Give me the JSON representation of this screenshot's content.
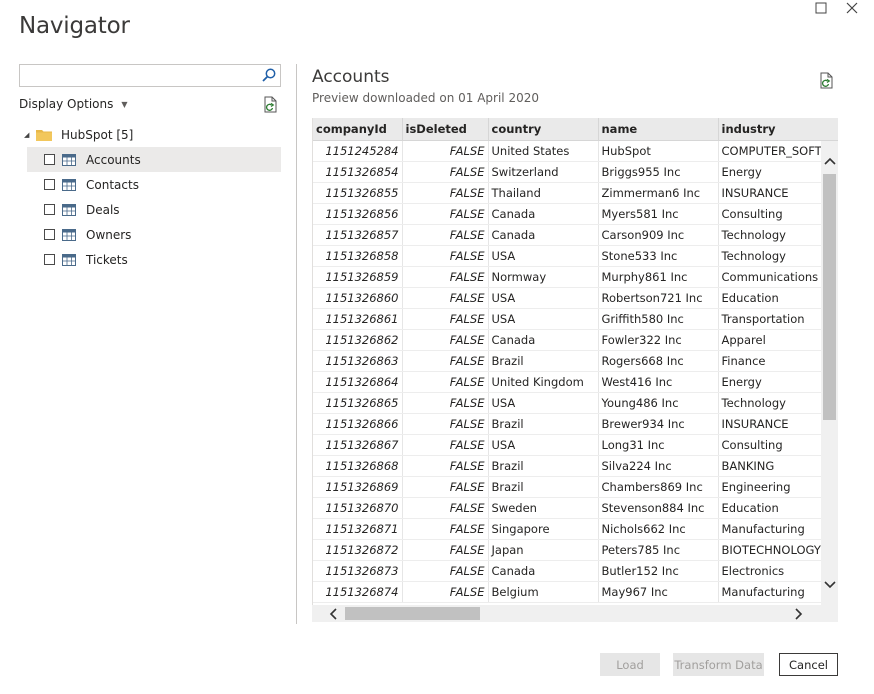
{
  "window": {
    "title": "Navigator"
  },
  "left_pane": {
    "search": {
      "value": "",
      "placeholder": ""
    },
    "display_options_label": "Display Options",
    "tree": {
      "root_label": "HubSpot [5]",
      "items": [
        {
          "label": "Accounts",
          "selected": true,
          "checked": false
        },
        {
          "label": "Contacts",
          "selected": false,
          "checked": false
        },
        {
          "label": "Deals",
          "selected": false,
          "checked": false
        },
        {
          "label": "Owners",
          "selected": false,
          "checked": false
        },
        {
          "label": "Tickets",
          "selected": false,
          "checked": false
        }
      ]
    }
  },
  "preview": {
    "title": "Accounts",
    "subtitle": "Preview downloaded on 01 April 2020",
    "columns": [
      "companyId",
      "isDeleted",
      "country",
      "name",
      "industry"
    ],
    "rows": [
      [
        "1151245284",
        "FALSE",
        "United States",
        "HubSpot",
        "COMPUTER_SOFTWARE"
      ],
      [
        "1151326854",
        "FALSE",
        "Switzerland",
        "Briggs955 Inc",
        "Energy"
      ],
      [
        "1151326855",
        "FALSE",
        "Thailand",
        "Zimmerman6 Inc",
        "INSURANCE"
      ],
      [
        "1151326856",
        "FALSE",
        "Canada",
        "Myers581 Inc",
        "Consulting"
      ],
      [
        "1151326857",
        "FALSE",
        "Canada",
        "Carson909 Inc",
        "Technology"
      ],
      [
        "1151326858",
        "FALSE",
        "USA",
        "Stone533 Inc",
        "Technology"
      ],
      [
        "1151326859",
        "FALSE",
        "Normway",
        "Murphy861 Inc",
        "Communications"
      ],
      [
        "1151326860",
        "FALSE",
        "USA",
        "Robertson721 Inc",
        "Education"
      ],
      [
        "1151326861",
        "FALSE",
        "USA",
        "Griffith580 Inc",
        "Transportation"
      ],
      [
        "1151326862",
        "FALSE",
        "Canada",
        "Fowler322 Inc",
        "Apparel"
      ],
      [
        "1151326863",
        "FALSE",
        "Brazil",
        "Rogers668 Inc",
        "Finance"
      ],
      [
        "1151326864",
        "FALSE",
        "United Kingdom",
        "West416 Inc",
        "Energy"
      ],
      [
        "1151326865",
        "FALSE",
        "USA",
        "Young486 Inc",
        "Technology"
      ],
      [
        "1151326866",
        "FALSE",
        "Brazil",
        "Brewer934 Inc",
        "INSURANCE"
      ],
      [
        "1151326867",
        "FALSE",
        "USA",
        "Long31 Inc",
        "Consulting"
      ],
      [
        "1151326868",
        "FALSE",
        "Brazil",
        "Silva224 Inc",
        "BANKING"
      ],
      [
        "1151326869",
        "FALSE",
        "Brazil",
        "Chambers869 Inc",
        "Engineering"
      ],
      [
        "1151326870",
        "FALSE",
        "Sweden",
        "Stevenson884 Inc",
        "Education"
      ],
      [
        "1151326871",
        "FALSE",
        "Singapore",
        "Nichols662 Inc",
        "Manufacturing"
      ],
      [
        "1151326872",
        "FALSE",
        "Japan",
        "Peters785 Inc",
        "BIOTECHNOLOGY"
      ],
      [
        "1151326873",
        "FALSE",
        "Canada",
        "Butler152 Inc",
        "Electronics"
      ],
      [
        "1151326874",
        "FALSE",
        "Belgium",
        "May967 Inc",
        "Manufacturing"
      ]
    ]
  },
  "footer": {
    "load_label": "Load",
    "transform_label": "Transform Data",
    "cancel_label": "Cancel"
  },
  "colors": {
    "selected_row": "#ebeae9",
    "header_bg": "#eaeaea",
    "folder": "#e8b84a",
    "disabled_button": "#e6e6e6"
  }
}
